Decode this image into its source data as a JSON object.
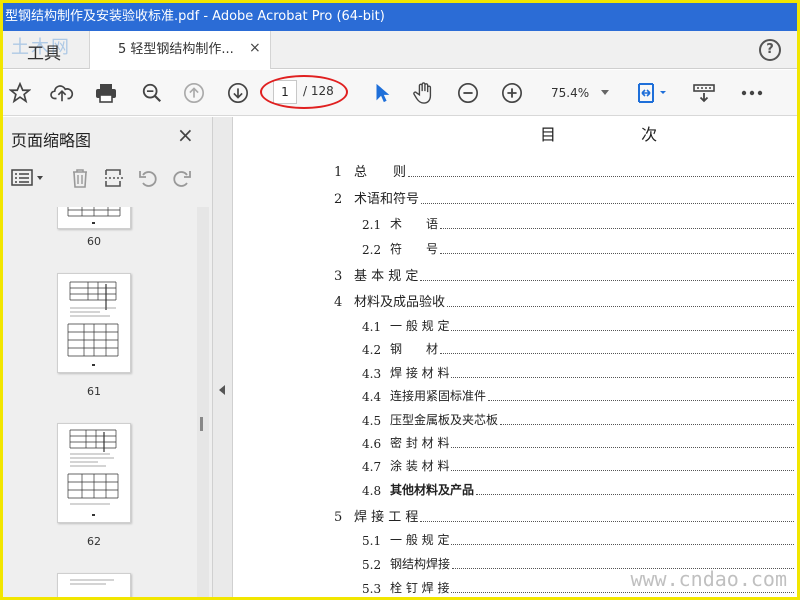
{
  "window": {
    "title": "型钢结构制作及安装验收标准.pdf - Adobe Acrobat Pro (64-bit)"
  },
  "watermarks": {
    "top": "土木网",
    "bottom": "www.cndao.com"
  },
  "tabs": {
    "tools_label": "工具",
    "doc_label": "5 轻型钢结构制作...",
    "close": "×",
    "help": "?"
  },
  "toolbar": {
    "page_current": "1",
    "page_total": "/ 128",
    "zoom": "75.4%",
    "icons": [
      "bookmark-star-icon",
      "upload-cloud-icon",
      "print-icon",
      "zoom-search-icon",
      "prev-page-icon",
      "next-page-icon",
      "select-cursor-icon",
      "hand-tool-icon",
      "zoom-out-icon",
      "zoom-in-icon",
      "fit-page-icon",
      "keyboard-icon",
      "more-icon"
    ]
  },
  "sidebar": {
    "title": "页面缩略图",
    "close": "×",
    "thumbnails": [
      {
        "page": "60"
      },
      {
        "page": "61"
      },
      {
        "page": "62"
      }
    ]
  },
  "document": {
    "title": "目 次",
    "toc": [
      {
        "level": 1,
        "num": "1",
        "label": "总　　则",
        "bold": false
      },
      {
        "level": 1,
        "num": "2",
        "label": "术语和符号",
        "bold": false
      },
      {
        "level": 2,
        "num": "2.1",
        "label": "术　　语",
        "bold": false
      },
      {
        "level": 2,
        "num": "2.2",
        "label": "符　　号",
        "bold": false
      },
      {
        "level": 1,
        "num": "3",
        "label": "基 本 规 定",
        "bold": false
      },
      {
        "level": 1,
        "num": "4",
        "label": "材料及成品验收",
        "bold": false
      },
      {
        "level": 2,
        "num": "4.1",
        "label": "一 般 规 定",
        "bold": false
      },
      {
        "level": 2,
        "num": "4.2",
        "label": "钢　　材",
        "bold": false
      },
      {
        "level": 2,
        "num": "4.3",
        "label": "焊 接 材 料",
        "bold": false
      },
      {
        "level": 2,
        "num": "4.4",
        "label": "连接用紧固标准件",
        "bold": false
      },
      {
        "level": 2,
        "num": "4.5",
        "label": "压型金属板及夹芯板",
        "bold": false
      },
      {
        "level": 2,
        "num": "4.6",
        "label": "密 封 材 料",
        "bold": false
      },
      {
        "level": 2,
        "num": "4.7",
        "label": "涂 装 材 料",
        "bold": false
      },
      {
        "level": 2,
        "num": "4.8",
        "label": "其他材料及产品",
        "bold": true
      },
      {
        "level": 1,
        "num": "5",
        "label": "焊 接 工 程",
        "bold": false
      },
      {
        "level": 2,
        "num": "5.1",
        "label": "一 般 规 定",
        "bold": false
      },
      {
        "level": 2,
        "num": "5.2",
        "label": "钢结构焊接",
        "bold": false
      },
      {
        "level": 2,
        "num": "5.3",
        "label": "栓 钉 焊 接",
        "bold": false
      }
    ]
  },
  "colors": {
    "titlebar": "#2b6cd6",
    "annotation": "#e02020",
    "accent_blue": "#1e6fd9"
  }
}
